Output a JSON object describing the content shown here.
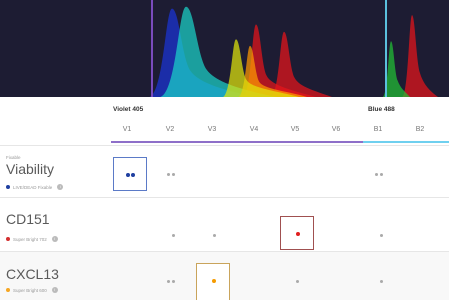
{
  "spectrum": {
    "peaks": [
      {
        "color": "#1b35d6",
        "height": 0.95
      },
      {
        "color": "#1ad3c7",
        "height": 0.97
      },
      {
        "color": "#dfe40b",
        "height": 0.62
      },
      {
        "color": "#ff9a00",
        "height": 0.55
      },
      {
        "color": "#e6151a",
        "height": 0.78
      },
      {
        "color": "#e6151a",
        "height": 0.7
      },
      {
        "color": "#21c234",
        "height": 0.6
      },
      {
        "color": "#e6151a",
        "height": 0.88
      }
    ],
    "laser_colors": [
      "#7a4bbd",
      "#5bc0de"
    ]
  },
  "lasers": [
    {
      "label": "Violet 405",
      "color": "#7e57c2"
    },
    {
      "label": "Blue 488",
      "color": "#4fc3f7"
    }
  ],
  "columns": [
    "V1",
    "V2",
    "V3",
    "V4",
    "V5",
    "V6",
    "B1",
    "B2"
  ],
  "rows": [
    {
      "small": "Fixable",
      "title": "Viability",
      "reagent": "LIVE/DEAD Fixable",
      "dot_color": "#1f3fa0"
    },
    {
      "title": "CD151",
      "reagent": "Super Bright 702",
      "dot_color": "#d32f2f"
    },
    {
      "title": "CXCL13",
      "reagent": "Super Bright 600",
      "dot_color": "#f5a623"
    }
  ]
}
